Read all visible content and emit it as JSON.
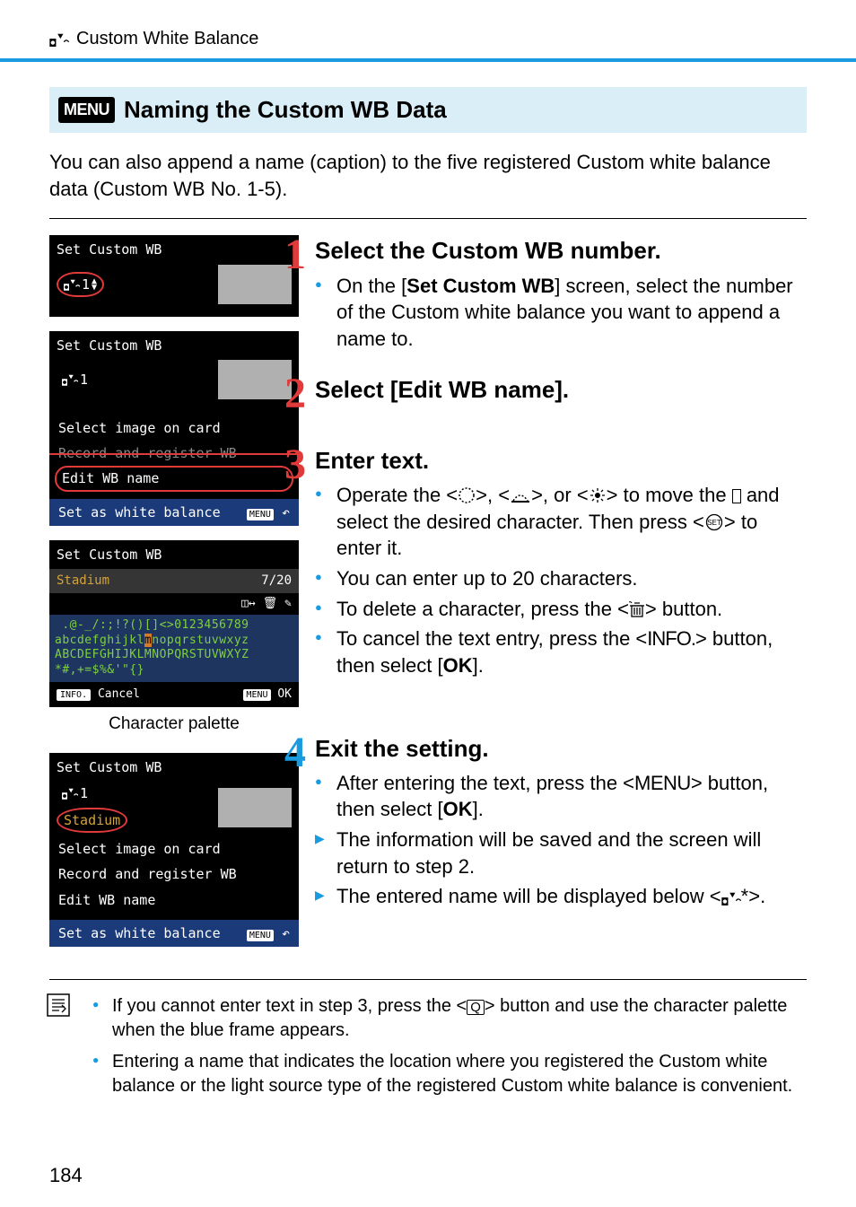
{
  "header": {
    "breadcrumb": "Custom White Balance"
  },
  "section": {
    "menu_label": "MENU",
    "title": "Naming the Custom WB Data"
  },
  "intro": "You can also append a name (caption) to the five registered Custom white balance data (Custom WB No. 1-5).",
  "screens": {
    "s1": {
      "title": "Set Custom WB",
      "num": "1"
    },
    "s2": {
      "title": "Set Custom WB",
      "num": "1",
      "opt1": "Select image on card",
      "opt2": "Record and register WB",
      "opt3": "Edit WB name",
      "set_btn": "Set as white balance",
      "menu": "MENU"
    },
    "s3": {
      "title": "Set Custom WB",
      "name": "Stadium",
      "count": "7/20",
      "pal1": " .@-_/:;!?()[]<>0123456789",
      "pal2a": "abcdefghijkl",
      "pal2m": "m",
      "pal2b": "nopqrstuvwxyz",
      "pal3": "ABCDEFGHIJKLMNOPQRSTUVWXYZ",
      "pal4": "*#,+=$%&'\"{}",
      "info": "INFO.",
      "cancel": "Cancel",
      "menu": "MENU",
      "ok": "OK"
    },
    "caption": "Character palette",
    "s4": {
      "title": "Set Custom WB",
      "num": "1",
      "name": "Stadium",
      "opt1": "Select image on card",
      "opt2": "Record and register WB",
      "opt3": "Edit WB name",
      "set_btn": "Set as white balance",
      "menu": "MENU"
    }
  },
  "steps": {
    "n1": "1",
    "t1": "Select the Custom WB number.",
    "b1a": "On the [",
    "b1b": "Set Custom WB",
    "b1c": "] screen, select the number of the Custom white balance you want to append a name to.",
    "n2": "2",
    "t2": "Select [Edit WB name].",
    "n3": "3",
    "t3": "Enter text.",
    "b3a_pre": "Operate the <",
    "b3a_mid1": ">, <",
    "b3a_mid2": ">, or <",
    "b3a_post": "> to move the ",
    "b3a_post2": " and select the desired character. Then press <",
    "b3a_end": "> to enter it.",
    "b3b": "You can enter up to 20 characters.",
    "b3c_pre": "To delete a character, press the <",
    "b3c_post": "> button.",
    "b3d_pre": "To cancel the text entry, press the <",
    "b3d_info": "INFO.",
    "b3d_mid": "> button, then select [",
    "b3d_ok": "OK",
    "b3d_end": "].",
    "n4": "4",
    "t4": "Exit the setting.",
    "b4a_pre": "After entering the text, press the <",
    "b4a_menu": "MENU",
    "b4a_mid": "> button, then select [",
    "b4a_ok": "OK",
    "b4a_end": "].",
    "b4b": "The information will be saved and the screen will return to step 2.",
    "b4c_pre": "The entered name will be displayed below <",
    "b4c_end": "*>."
  },
  "notes": {
    "n1_pre": "If you cannot enter text in step 3, press the <",
    "n1_post": "> button and use the character palette when the blue frame appears.",
    "n2": "Entering a name that indicates the location where you registered the Custom white balance or the light source type of the registered Custom white balance is convenient."
  },
  "page": "184"
}
